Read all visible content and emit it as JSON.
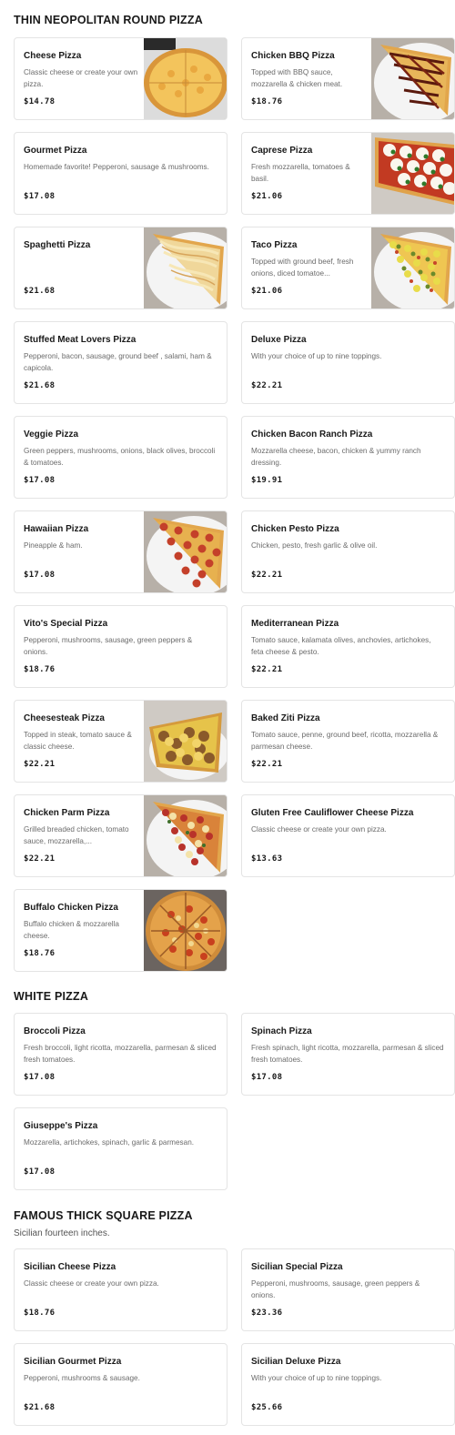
{
  "sections": [
    {
      "title": "THIN NEOPOLITAN ROUND PIZZA",
      "subtitle": "",
      "items": [
        {
          "name": "Cheese Pizza",
          "desc": "Classic cheese or create your own pizza.",
          "price": "$14.78",
          "image": "cheese-pizza-image"
        },
        {
          "name": "Chicken BBQ Pizza",
          "desc": "Topped with BBQ sauce, mozzarella & chicken meat.",
          "price": "$18.76",
          "image": "bbq-pizza-image"
        },
        {
          "name": "Gourmet Pizza",
          "desc": "Homemade favorite! Pepperoni, sausage & mushrooms.",
          "price": "$17.08",
          "image": ""
        },
        {
          "name": "Caprese Pizza",
          "desc": "Fresh mozzarella, tomatoes & basil.",
          "price": "$21.06",
          "image": "caprese-pizza-image"
        },
        {
          "name": "Spaghetti Pizza",
          "desc": "",
          "price": "$21.68",
          "image": "spaghetti-pizza-image"
        },
        {
          "name": "Taco Pizza",
          "desc": "Topped with ground beef, fresh onions, diced tomatoe...",
          "price": "$21.06",
          "image": "taco-pizza-image"
        },
        {
          "name": "Stuffed Meat Lovers Pizza",
          "desc": "Pepperoni, bacon, sausage, ground beef , salami, ham & capicola.",
          "price": "$21.68",
          "image": ""
        },
        {
          "name": "Deluxe Pizza",
          "desc": "With your choice of up to nine toppings.",
          "price": "$22.21",
          "image": ""
        },
        {
          "name": "Veggie Pizza",
          "desc": "Green peppers, mushrooms, onions, black olives, broccoli & tomatoes.",
          "price": "$17.08",
          "image": ""
        },
        {
          "name": "Chicken Bacon Ranch Pizza",
          "desc": "Mozzarella cheese, bacon, chicken & yummy ranch dressing.",
          "price": "$19.91",
          "image": ""
        },
        {
          "name": "Hawaiian Pizza",
          "desc": "Pineapple & ham.",
          "price": "$17.08",
          "image": "hawaiian-pizza-image"
        },
        {
          "name": "Chicken Pesto Pizza",
          "desc": "Chicken, pesto, fresh garlic & olive oil.",
          "price": "$22.21",
          "image": ""
        },
        {
          "name": "Vito's Special Pizza",
          "desc": "Pepperoni, mushrooms, sausage, green peppers & onions.",
          "price": "$18.76",
          "image": ""
        },
        {
          "name": "Mediterranean Pizza",
          "desc": "Tomato sauce, kalamata olives, anchovies, artichokes, feta cheese & pesto.",
          "price": "$22.21",
          "image": ""
        },
        {
          "name": "Cheesesteak Pizza",
          "desc": "Topped in steak, tomato sauce & classic cheese.",
          "price": "$22.21",
          "image": "cheesesteak-pizza-image"
        },
        {
          "name": "Baked Ziti Pizza",
          "desc": "Tomato sauce, penne, ground beef, ricotta, mozzarella & parmesan cheese.",
          "price": "$22.21",
          "image": ""
        },
        {
          "name": "Chicken Parm Pizza",
          "desc": "Grilled breaded chicken, tomato sauce, mozzarella,...",
          "price": "$22.21",
          "image": "chicken-parm-pizza-image"
        },
        {
          "name": "Gluten Free Cauliflower Cheese Pizza",
          "desc": "Classic cheese or create your own pizza.",
          "price": "$13.63",
          "image": ""
        },
        {
          "name": "Buffalo Chicken Pizza",
          "desc": "Buffalo chicken & mozzarella cheese.",
          "price": "$18.76",
          "image": "buffalo-chicken-pizza-image"
        }
      ]
    },
    {
      "title": "WHITE PIZZA",
      "subtitle": "",
      "items": [
        {
          "name": "Broccoli Pizza",
          "desc": "Fresh broccoli, light ricotta, mozzarella, parmesan & sliced fresh tomatoes.",
          "price": "$17.08",
          "image": ""
        },
        {
          "name": "Spinach Pizza",
          "desc": "Fresh spinach, light ricotta, mozzarella, parmesan & sliced fresh tomatoes.",
          "price": "$17.08",
          "image": ""
        },
        {
          "name": "Giuseppe's Pizza",
          "desc": "Mozzarella, artichokes, spinach, garlic & parmesan.",
          "price": "$17.08",
          "image": ""
        }
      ]
    },
    {
      "title": "FAMOUS THICK SQUARE PIZZA",
      "subtitle": "Sicilian fourteen inches.",
      "items": [
        {
          "name": "Sicilian Cheese Pizza",
          "desc": "Classic cheese or create your own pizza.",
          "price": "$18.76",
          "image": ""
        },
        {
          "name": "Sicilian Special Pizza",
          "desc": "Pepperoni, mushrooms, sausage, green peppers & onions.",
          "price": "$23.36",
          "image": ""
        },
        {
          "name": "Sicilian Gourmet Pizza",
          "desc": "Pepperoni, mushrooms & sausage.",
          "price": "$21.68",
          "image": ""
        },
        {
          "name": "Sicilian Deluxe Pizza",
          "desc": "With your choice of up to nine toppings.",
          "price": "$25.66",
          "image": ""
        }
      ]
    }
  ],
  "colors": {
    "text": "#191919",
    "muted": "#6b6b6b",
    "border": "#e4e4e4",
    "crust": "#d9a24b",
    "cheese": "#f2c35a",
    "sauce": "#b3361e",
    "plate": "#f4f4f4",
    "table": "#b7b0a8"
  }
}
